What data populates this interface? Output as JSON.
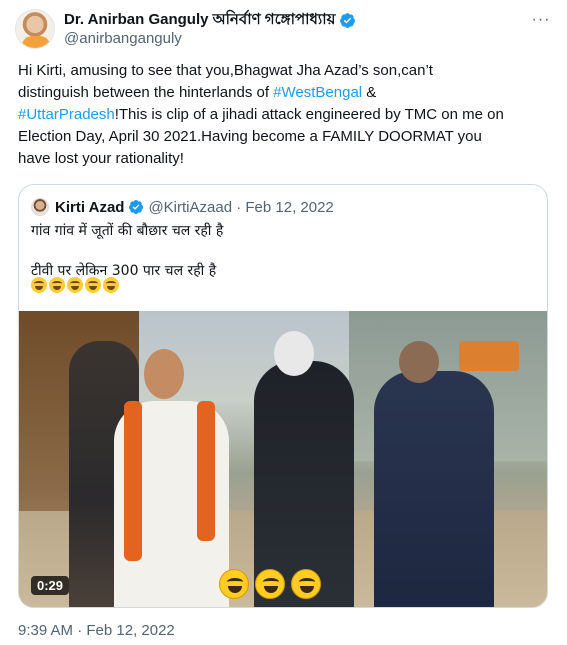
{
  "author": {
    "display_name": "Dr. Anirban Ganguly অনির্বাণ গঙ্গোপাধ্যায়",
    "handle": "@anirbanganguly",
    "verified": true
  },
  "menu": {
    "more_label": "···"
  },
  "tweet": {
    "lines": [
      [
        "Hi Kirti, amusing to see that you,Bhagwat Jha Azad’s son,can’t"
      ],
      [
        "distinguish between the hinterlands of ",
        "#WestBengal",
        " &"
      ],
      [
        "#UttarPradesh",
        "!This is clip of a jihadi attack engineered by TMC on me on"
      ],
      [
        "Election Day, April 30 2021.Having become a FAMILY DOORMAT you"
      ],
      [
        "have lost your rationality!"
      ]
    ],
    "hashtags": [
      "#WestBengal",
      "#UttarPradesh"
    ],
    "timestamp": "9:39 AM · Feb 12, 2022"
  },
  "quoted_tweet": {
    "display_name": "Kirti Azad",
    "verified": true,
    "handle_date": "@KirtiAzaad · Feb 12, 2022",
    "text_line_1": "गांव गांव में जूतों की बौछार चल रही है",
    "text_line_2": "टीवी पर लेकिन 300 पार चल रही है",
    "emoji_count": 5,
    "emoji_icon": "rolling-on-floor-laughing-emoji",
    "video": {
      "duration": "0:29",
      "overlay_emoji_icon": "laughing-emoji",
      "overlay_emoji_count": 3
    }
  },
  "colors": {
    "link": "#1d9bf0",
    "secondary_text": "#536471",
    "border": "#cfd9de"
  }
}
